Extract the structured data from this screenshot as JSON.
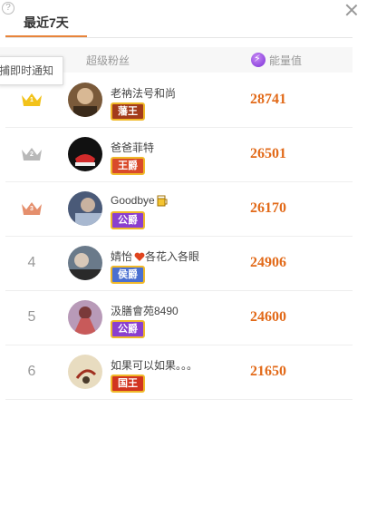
{
  "header": {
    "help": "?",
    "tab_label": "最近7天"
  },
  "columns": {
    "fans": "超级粉丝",
    "energy": "能量值"
  },
  "tooltip": "捕即时通知",
  "rows": [
    {
      "rank": "1",
      "rank_type": "gold",
      "name": "老衲法号和尚",
      "badge": "藩王",
      "badge_color": "#a33b1b",
      "energy": "28741"
    },
    {
      "rank": "2",
      "rank_type": "silver",
      "name": "爸爸菲特",
      "badge": "王爵",
      "badge_color": "#d94a2a",
      "energy": "26501"
    },
    {
      "rank": "3",
      "rank_type": "bronze",
      "name": "Goodbye",
      "badge": "公爵",
      "badge_color": "#8a3fcf",
      "energy": "26170"
    },
    {
      "rank": "4",
      "rank_type": "plain",
      "name": "婧怡",
      "name_suffix": "各花入各眼",
      "badge": "侯爵",
      "badge_color": "#4a6fd1",
      "energy": "24906"
    },
    {
      "rank": "5",
      "rank_type": "plain",
      "name": "汲膳會苑8490",
      "badge": "公爵",
      "badge_color": "#8a3fcf",
      "energy": "24600"
    },
    {
      "rank": "6",
      "rank_type": "plain",
      "name": "如果可以如果。。。",
      "badge": "国王",
      "badge_color": "#d1341f",
      "energy": "21650"
    }
  ],
  "colors": {
    "accent": "#e8843a",
    "energy": "#e26a19",
    "gold": "#f2c21a",
    "silver": "#b8b8b8",
    "bronze": "#e58f6d"
  }
}
